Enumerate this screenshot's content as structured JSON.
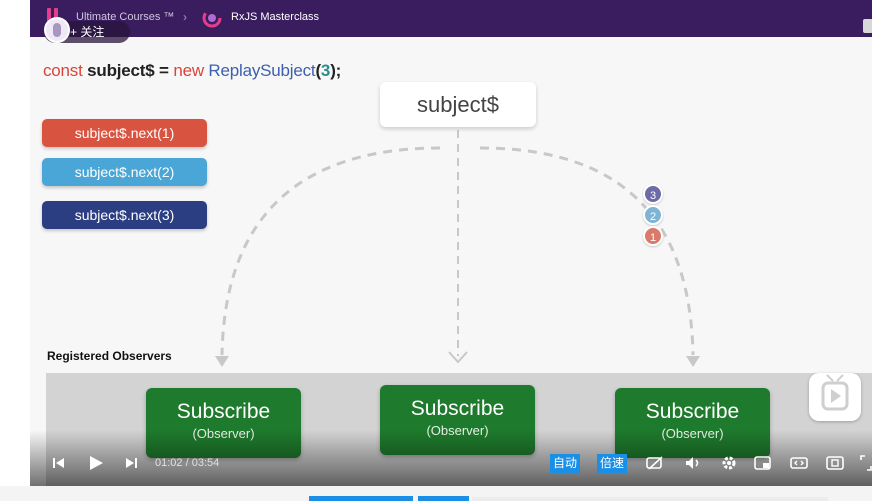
{
  "header": {
    "course": "Ultimate Courses ™",
    "separator": "›",
    "lesson": "RxJS Masterclass",
    "follow_label": "+ 关注"
  },
  "slide": {
    "code": {
      "kw1": "const ",
      "var": "subject$",
      "op": " = ",
      "kw2": "new ",
      "cls": "ReplaySubject",
      "open": "(",
      "arg": "3",
      "close": ");"
    },
    "subject_label": "subject$",
    "next_calls": [
      "subject$.next(1)",
      "subject$.next(2)",
      "subject$.next(3)"
    ],
    "buffer_values": [
      "3",
      "2",
      "1"
    ],
    "observers_label": "Registered Observers",
    "subscribers": [
      {
        "title": "Subscribe",
        "sub": "(Observer)"
      },
      {
        "title": "Subscribe",
        "sub": "(Observer)"
      },
      {
        "title": "Subscribe",
        "sub": "(Observer)"
      }
    ]
  },
  "controls": {
    "current_time": "01:02",
    "duration": "03:54",
    "time_sep": " / ",
    "auto_label": "自动",
    "speed_label": "倍速"
  },
  "colors": {
    "header_bg": "#3a1d5e",
    "next1": "#d95440",
    "next2": "#4aa6d6",
    "next3": "#2c3e82",
    "subscribe": "#1e7a2c",
    "accent": "#1b8fe6"
  }
}
